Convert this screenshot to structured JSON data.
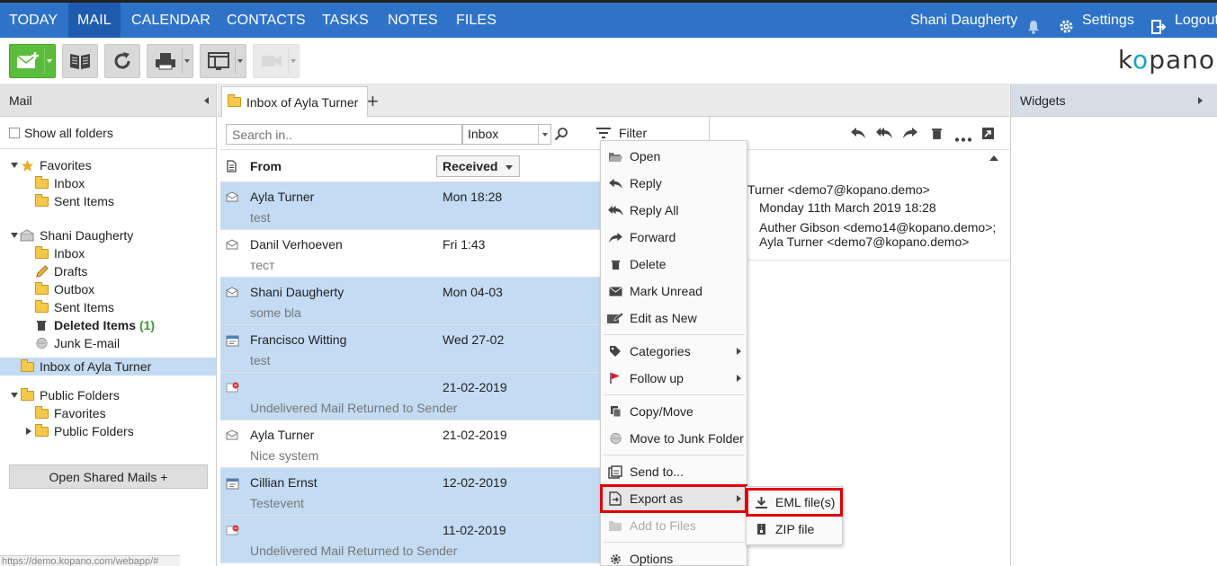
{
  "nav": {
    "items": [
      "TODAY",
      "MAIL",
      "CALENDAR",
      "CONTACTS",
      "TASKS",
      "NOTES",
      "FILES"
    ],
    "active": "MAIL",
    "user": "Shani Daugherty",
    "settings": "Settings",
    "logout": "Logout"
  },
  "logo": {
    "pre": "k",
    "o": "o",
    "post": "pano"
  },
  "leftpanel": {
    "title": "Mail",
    "show_all": "Show all folders",
    "favorites": {
      "label": "Favorites",
      "items": [
        "Inbox",
        "Sent Items"
      ]
    },
    "mailbox": {
      "label": "Shani Daugherty",
      "items": [
        "Inbox",
        "Drafts",
        "Outbox",
        "Sent Items",
        "Deleted Items",
        "Junk E-mail"
      ],
      "deleted_count": "(1)"
    },
    "shared_inbox": "Inbox of Ayla Turner",
    "public": {
      "label": "Public Folders",
      "items": [
        "Favorites",
        "Public Folders"
      ]
    },
    "open_shared": "Open Shared Mails +"
  },
  "status_url": "https://demo.kopano.com/webapp/#",
  "tabs": {
    "active": "Inbox of Ayla Turner"
  },
  "search": {
    "placeholder": "Search in..",
    "scope": "Inbox",
    "filter": "Filter"
  },
  "list": {
    "col_from": "From",
    "col_received": "Received",
    "rows": [
      {
        "sender": "Ayla Turner",
        "date": "Mon 18:28",
        "subject": "test",
        "selected": true
      },
      {
        "sender": "Danil Verhoeven",
        "date": "Fri 1:43",
        "subject": "тест",
        "selected": false
      },
      {
        "sender": "Shani Daugherty",
        "date": "Mon 04-03",
        "subject": "some bla",
        "selected": true
      },
      {
        "sender": "Francisco Witting",
        "date": "Wed 27-02",
        "subject": "test",
        "selected": true
      },
      {
        "sender": "",
        "date": "21-02-2019",
        "subject": "Undelivered Mail Returned to Sender",
        "selected": true
      },
      {
        "sender": "Ayla Turner",
        "date": "21-02-2019",
        "subject": "Nice system",
        "selected": false
      },
      {
        "sender": "Cillian Ernst",
        "date": "12-02-2019",
        "subject": "Testevent",
        "selected": true
      },
      {
        "sender": "",
        "date": "11-02-2019",
        "subject": "Undelivered Mail Returned to Sender",
        "selected": true
      }
    ]
  },
  "reading": {
    "from": "Turner <demo7@kopano.demo>",
    "sent": "Monday 11th March 2019 18:28",
    "to1": "Auther Gibson <demo14@kopano.demo>;",
    "to2": "Ayla Turner <demo7@kopano.demo>"
  },
  "widgets": {
    "title": "Widgets"
  },
  "context_menu": {
    "open": "Open",
    "reply": "Reply",
    "reply_all": "Reply All",
    "forward": "Forward",
    "delete": "Delete",
    "mark_unread": "Mark Unread",
    "edit_as_new": "Edit as New",
    "categories": "Categories",
    "follow_up": "Follow up",
    "copy_move": "Copy/Move",
    "move_junk": "Move to Junk Folder",
    "send_to": "Send to...",
    "export_as": "Export as",
    "add_to_files": "Add to Files",
    "options": "Options"
  },
  "submenu": {
    "eml": "EML file(s)",
    "zip": "ZIP file"
  },
  "colors": {
    "nav_bg": "#2f73c9",
    "nav_active": "#1f5cb0",
    "selected_row": "#c3dbf3",
    "highlight": "#e00000",
    "new_mail_green": "#5bbd3c"
  }
}
